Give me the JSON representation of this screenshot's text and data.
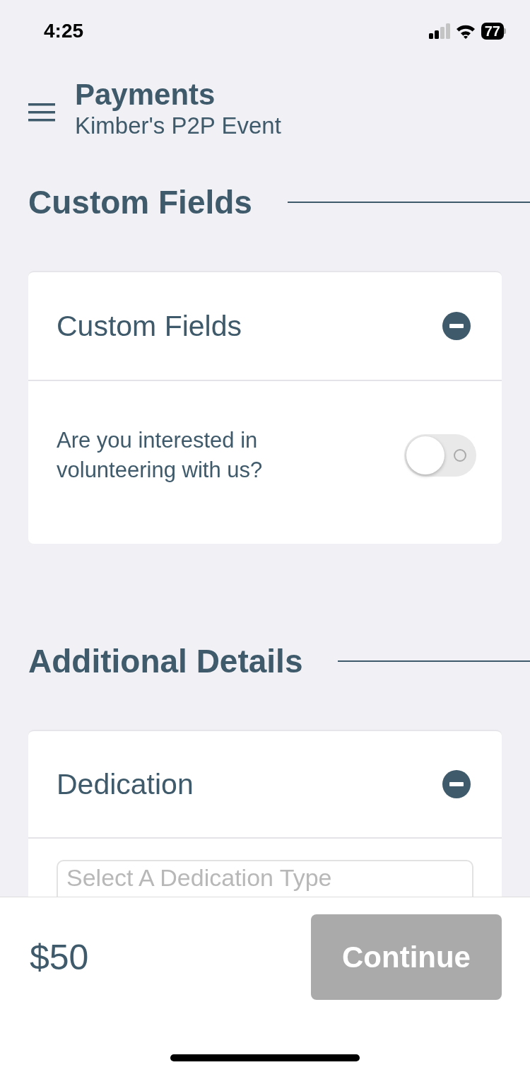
{
  "status_bar": {
    "time": "4:25",
    "battery": "77"
  },
  "header": {
    "title": "Payments",
    "subtitle": "Kimber's P2P Event"
  },
  "sections": [
    {
      "heading": "Custom Fields",
      "card": {
        "title": "Custom Fields",
        "expanded": true,
        "fields": [
          {
            "kind": "toggle",
            "label": "Are you interested in volunteering with us?",
            "on": false
          }
        ]
      }
    },
    {
      "heading": "Additional Details",
      "card": {
        "title": "Dedication",
        "expanded": true,
        "fields": [
          {
            "kind": "select",
            "placeholder": "Select A Dedication Type"
          }
        ]
      }
    }
  ],
  "footer": {
    "amount": "$50",
    "button": {
      "label": "Continue",
      "disabled": true
    }
  }
}
